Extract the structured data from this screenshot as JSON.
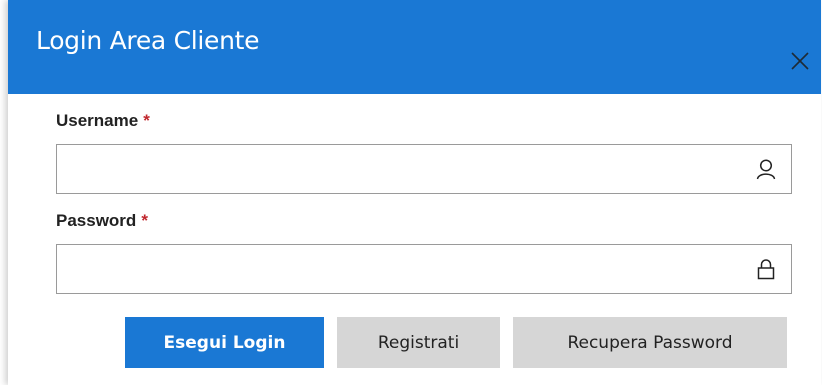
{
  "dialog": {
    "title": "Login Area Cliente",
    "close_icon": "close-icon"
  },
  "form": {
    "username": {
      "label": "Username",
      "required_mark": "*",
      "value": "",
      "icon": "user-icon"
    },
    "password": {
      "label": "Password",
      "required_mark": "*",
      "value": "",
      "icon": "lock-icon"
    }
  },
  "buttons": {
    "login_label": "Esegui Login",
    "register_label": "Registrati",
    "recover_label": "Recupera Password"
  },
  "colors": {
    "accent": "#1a78d4",
    "secondary_button": "#d6d6d6",
    "required": "#c0262d"
  }
}
